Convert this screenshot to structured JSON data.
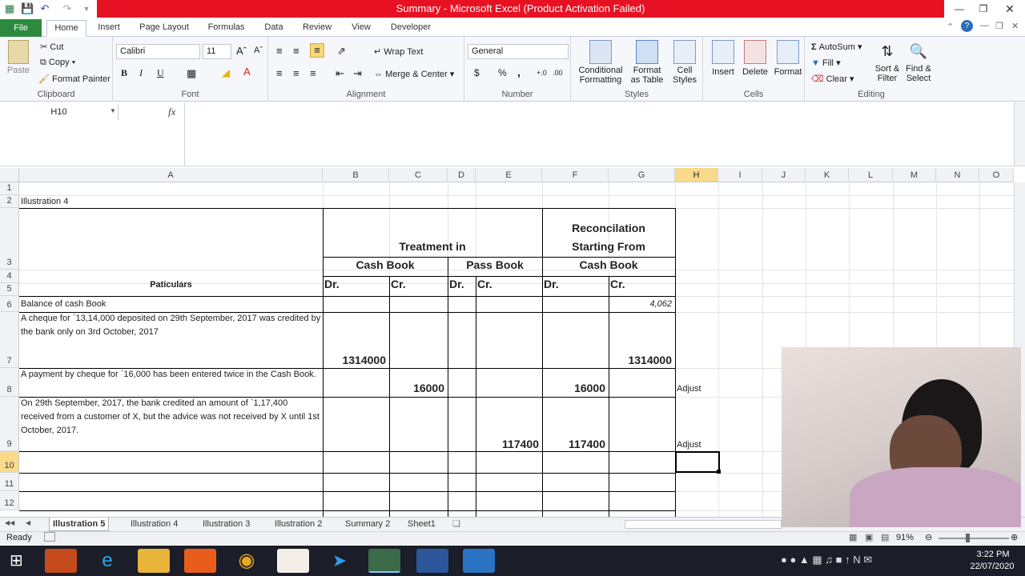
{
  "window": {
    "title": "Summary - Microsoft Excel (Product Activation Failed)"
  },
  "ribbon_tabs": [
    {
      "label": "File"
    },
    {
      "label": "Home"
    },
    {
      "label": "Insert"
    },
    {
      "label": "Page Layout"
    },
    {
      "label": "Formulas"
    },
    {
      "label": "Data"
    },
    {
      "label": "Review"
    },
    {
      "label": "View"
    },
    {
      "label": "Developer"
    }
  ],
  "ribbon": {
    "clipboard": {
      "paste": "Paste",
      "cut": "Cut",
      "copy": "Copy",
      "format_painter": "Format Painter",
      "label": "Clipboard"
    },
    "font": {
      "font_name": "Calibri",
      "font_size": "11",
      "bold": "B",
      "italic": "I",
      "underline": "U",
      "label": "Font"
    },
    "alignment": {
      "wrap_text": "Wrap Text",
      "merge_center": "Merge & Center",
      "label": "Alignment"
    },
    "number": {
      "format": "General",
      "currency": "$",
      "percent": "%",
      "comma": ",",
      "label": "Number"
    },
    "styles": {
      "conditional_1": "Conditional",
      "conditional_2": "Formatting",
      "format_as_1": "Format",
      "format_as_2": "as Table",
      "cell_styles_1": "Cell",
      "cell_styles_2": "Styles",
      "label": "Styles"
    },
    "cells": {
      "insert": "Insert",
      "delete": "Delete",
      "format": "Format",
      "label": "Cells"
    },
    "editing": {
      "autosum": "AutoSum",
      "fill": "Fill",
      "clear": "Clear",
      "sort_1": "Sort &",
      "sort_2": "Filter",
      "find_1": "Find &",
      "find_2": "Select",
      "label": "Editing"
    }
  },
  "formula_bar": {
    "name_box": "H10",
    "fx": "fx",
    "content": ""
  },
  "columns": [
    {
      "label": "A"
    },
    {
      "label": "B"
    },
    {
      "label": "C"
    },
    {
      "label": "D"
    },
    {
      "label": "E"
    },
    {
      "label": "F"
    },
    {
      "label": "G"
    },
    {
      "label": "H"
    },
    {
      "label": "I"
    },
    {
      "label": "J"
    },
    {
      "label": "K"
    },
    {
      "label": "L"
    },
    {
      "label": "M"
    },
    {
      "label": "N"
    },
    {
      "label": "O"
    }
  ],
  "rows": [
    "1",
    "2",
    "3",
    "4",
    "5",
    "6",
    "7",
    "8",
    "9",
    "10",
    "11",
    "12"
  ],
  "sheet": {
    "a2": "Illustration 4",
    "b3": "Treatment in",
    "f3a": "Reconcilation",
    "f3b": "Starting From",
    "b4": "Cash Book",
    "d4": "Pass Book",
    "f4": "Cash Book",
    "a5": "Paticulars",
    "b5": "Dr.",
    "c5": "Cr.",
    "d5": "Dr.",
    "e5": "Cr.",
    "f5": "Dr.",
    "g5": "Cr.",
    "a6": "Balance of cash Book",
    "g6": "4,062",
    "a7": "A cheque for `13,14,000 deposited on 29th September, 2017 was credited by the bank only on 3rd October, 2017",
    "b7": "1314000",
    "g7": "1314000",
    "a8": "A payment by cheque for `16,000 has been entered twice in the Cash Book.",
    "c8": "16000",
    "f8": "16000",
    "h8": "Adjust",
    "a9": "On 29th September, 2017, the bank credited an amount of `1,17,400 received from a customer of X, but the advice was not received by X until 1st October, 2017.",
    "e9": "117400",
    "f9": "117400",
    "h9": "Adjust"
  },
  "sheet_tabs": [
    {
      "label": "Illustration 5",
      "active": true
    },
    {
      "label": "Illustration 4"
    },
    {
      "label": "Illustration 3"
    },
    {
      "label": "Illustration 2"
    },
    {
      "label": "Summary 2"
    },
    {
      "label": "Sheet1"
    }
  ],
  "status": {
    "ready": "Ready",
    "zoom": "91%"
  },
  "taskbar": {
    "time": "3:22 PM",
    "date": "22/07/2020"
  },
  "colors": {
    "title_red": "#e81123",
    "file_green": "#2b8a3e",
    "selected_header": "#f9d98a"
  }
}
